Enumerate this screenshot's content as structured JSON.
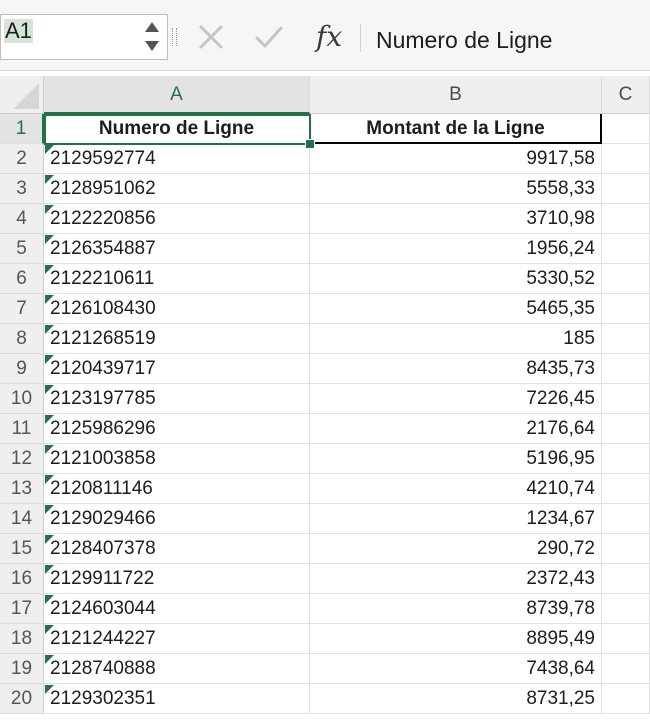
{
  "formula_bar": {
    "name_box": "A1",
    "fx_label": "fx",
    "content": "Numero de Ligne"
  },
  "columns": [
    "A",
    "B",
    "C"
  ],
  "colors": {
    "accent": "#217346",
    "header_bg": "#efefef"
  },
  "rows": [
    {
      "num": "1",
      "a": "Numero de Ligne",
      "b": "Montant de la Ligne"
    },
    {
      "num": "2",
      "a": "2129592774",
      "b": "9917,58"
    },
    {
      "num": "3",
      "a": "2128951062",
      "b": "5558,33"
    },
    {
      "num": "4",
      "a": "2122220856",
      "b": "3710,98"
    },
    {
      "num": "5",
      "a": "2126354887",
      "b": "1956,24"
    },
    {
      "num": "6",
      "a": "2122210611",
      "b": "5330,52"
    },
    {
      "num": "7",
      "a": "2126108430",
      "b": "5465,35"
    },
    {
      "num": "8",
      "a": "2121268519",
      "b": "185"
    },
    {
      "num": "9",
      "a": "2120439717",
      "b": "8435,73"
    },
    {
      "num": "10",
      "a": "2123197785",
      "b": "7226,45"
    },
    {
      "num": "11",
      "a": "2125986296",
      "b": "2176,64"
    },
    {
      "num": "12",
      "a": "2121003858",
      "b": "5196,95"
    },
    {
      "num": "13",
      "a": "2120811146",
      "b": "4210,74"
    },
    {
      "num": "14",
      "a": "2129029466",
      "b": "1234,67"
    },
    {
      "num": "15",
      "a": "2128407378",
      "b": "290,72"
    },
    {
      "num": "16",
      "a": "2129911722",
      "b": "2372,43"
    },
    {
      "num": "17",
      "a": "2124603044",
      "b": "8739,78"
    },
    {
      "num": "18",
      "a": "2121244227",
      "b": "8895,49"
    },
    {
      "num": "19",
      "a": "2128740888",
      "b": "7438,64"
    },
    {
      "num": "20",
      "a": "2129302351",
      "b": "8731,25"
    }
  ]
}
